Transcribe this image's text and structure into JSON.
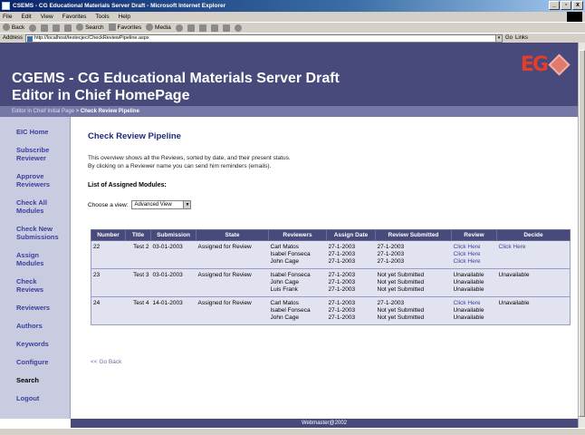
{
  "window": {
    "title": "CSEMS - CG Educational Materials Server Draft - Microsoft Internet Explorer",
    "min": "_",
    "max": "▫",
    "close": "x"
  },
  "menu": [
    "File",
    "Edit",
    "View",
    "Favorites",
    "Tools",
    "Help"
  ],
  "toolbar": {
    "back": "Back",
    "search": "Search",
    "favorites": "Favorites",
    "media": "Media"
  },
  "address": {
    "label": "Address",
    "url": "http://localhost/testecjec/CheckReviewPipeline.aspx",
    "go": "Go",
    "links": "Links"
  },
  "header": {
    "title_line1": "CGEMS - CG Educational Materials Server Draft",
    "title_line2": "Editor in Chief HomePage",
    "logo_text": "EG"
  },
  "breadcrumb": {
    "parent": "Editor in Chief Initial Page",
    "sep": " > ",
    "current": "Check Review Pipeline"
  },
  "sidebar": {
    "items": [
      "EIC Home",
      "Subscribe Reviewer",
      "Approve Reviewers",
      "Check All Modules",
      "Check New Submissions",
      "Assign Modules",
      "Check Reviews",
      "Reviewers",
      "Authors",
      "Keywords",
      "Configure",
      "Search",
      "Logout"
    ]
  },
  "main": {
    "title": "Check Review Pipeline",
    "intro_line1": "This overview shows all the Reviews, sorted by date, and their present status.",
    "intro_line2": "By clicking on a Reviewer name you can send him reminders (emails).",
    "list_title": "List of Assigned Modules:",
    "view_label": "Choose a view:",
    "view_value": "Advanced View",
    "go_back": "<< Go Back"
  },
  "table": {
    "columns": [
      "Number",
      "Title",
      "Submission",
      "State",
      "Reviewers",
      "Assign Date",
      "Review Submitted",
      "Review",
      "Decide"
    ],
    "rows": [
      {
        "number": "22",
        "title": "Test 2",
        "submission": "03-01-2003",
        "state": "Assigned for Review",
        "reviewers": [
          "Carl Matos",
          "Isabel Fonseca",
          "John Cage"
        ],
        "assign_dates": [
          "27-1-2003",
          "27-1-2003",
          "27-1-2003"
        ],
        "submitted": [
          "27-1-2003",
          "27-1-2003",
          "27-1-2003"
        ],
        "review": [
          "Click Here",
          "Click Here",
          "Click Here"
        ],
        "decide": "Click Here"
      },
      {
        "number": "23",
        "title": "Test 3",
        "submission": "03-01-2003",
        "state": "Assigned for Review",
        "reviewers": [
          "Isabel Fonseca",
          "John Cage",
          "Luis Frank"
        ],
        "assign_dates": [
          "27-1-2003",
          "27-1-2003",
          "27-1-2003"
        ],
        "submitted": [
          "Not yet Submitted",
          "Not yet Submitted",
          "Not yet Submitted"
        ],
        "review": [
          "Unavailable",
          "Unavailable",
          "Unavailable"
        ],
        "decide": "Unavailable"
      },
      {
        "number": "24",
        "title": "Test 4",
        "submission": "14-01-2003",
        "state": "Assigned for Review",
        "reviewers": [
          "Carl Matos",
          "Isabel Fonseca",
          "John Cage"
        ],
        "assign_dates": [
          "27-1-2003",
          "27-1-2003",
          "27-1-2003"
        ],
        "submitted": [
          "27-1-2003",
          "Not yet Submitted",
          "Not yet Submitted"
        ],
        "review": [
          "Click Here",
          "Unavailable",
          "Unavailable"
        ],
        "decide": "Unavailable"
      }
    ]
  },
  "footer": {
    "text": "Webmaster@2002"
  },
  "colors": {
    "header": "#474a7a",
    "breadcrumb": "#7577a6",
    "sidebar": "#c9cbe0",
    "link": "#3a3f9a",
    "logo": "#e53c2b"
  }
}
